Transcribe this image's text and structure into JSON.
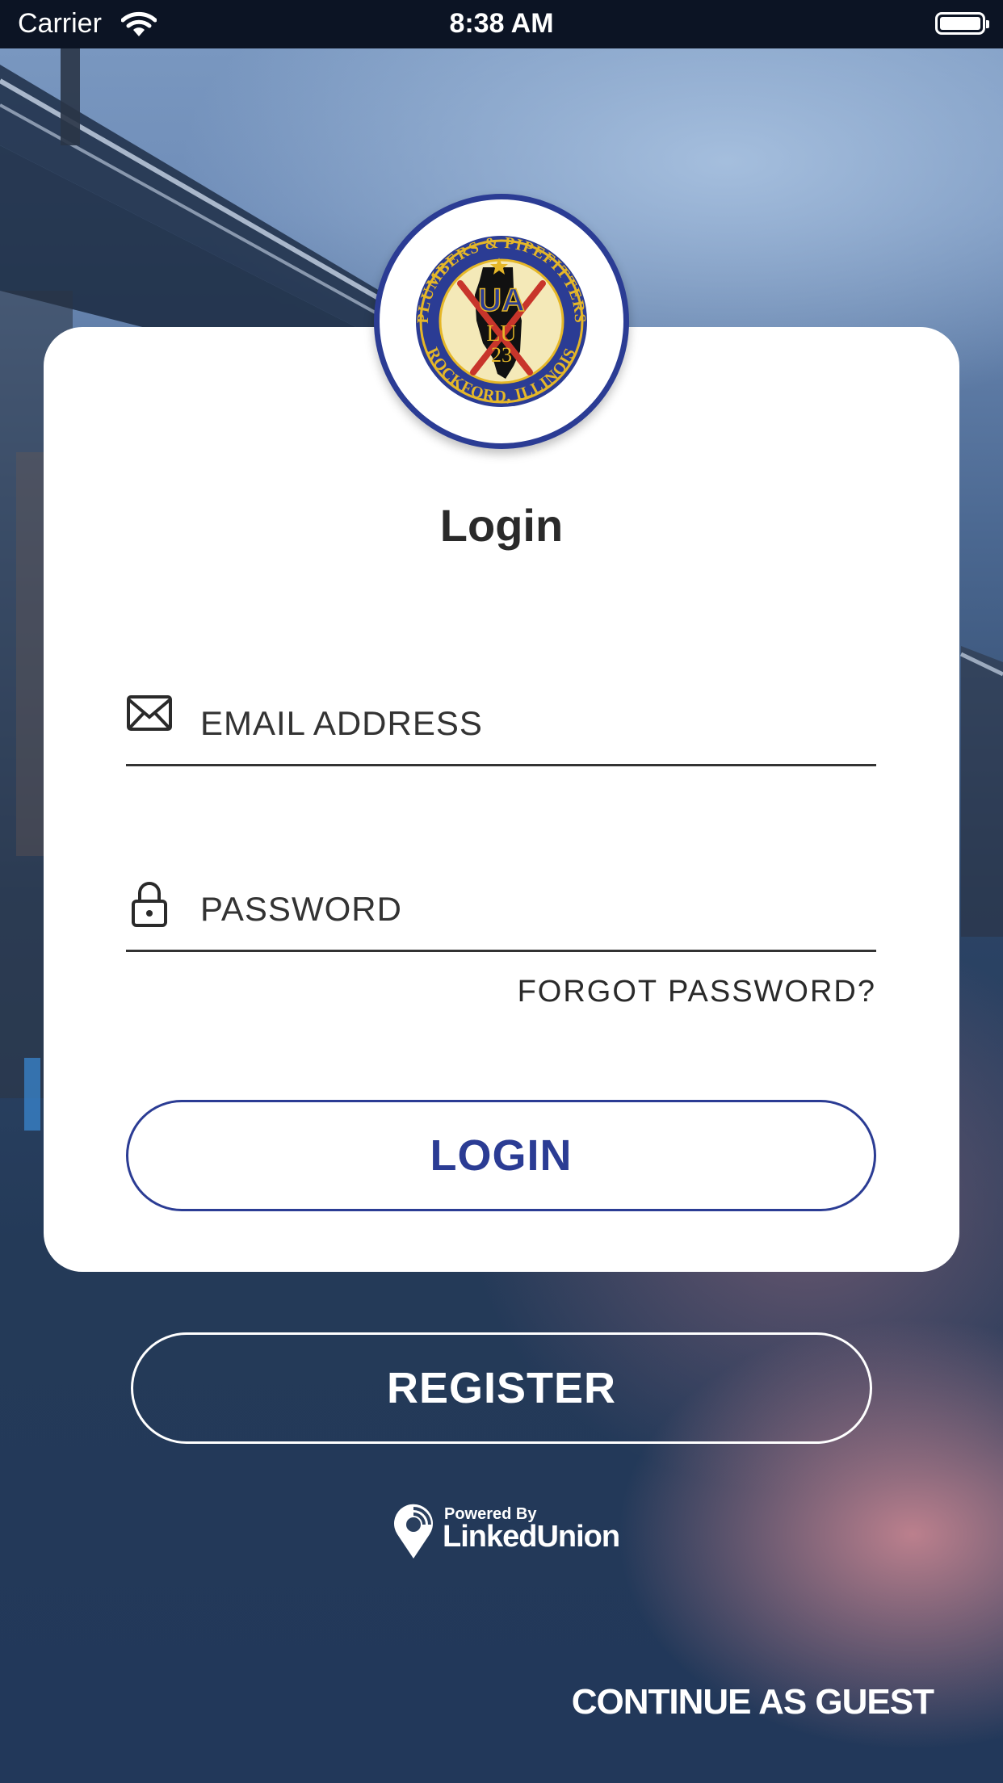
{
  "status_bar": {
    "carrier": "Carrier",
    "time": "8:38 AM"
  },
  "logo": {
    "ring_top": "PLUMBERS & PIPEFITTERS",
    "ring_bottom": "ROCKFORD, ILLINOIS",
    "center_top": "UA",
    "center_middle": "LU",
    "center_bottom": "23"
  },
  "login_card": {
    "title": "Login",
    "email_placeholder": "EMAIL ADDRESS",
    "email_value": "",
    "password_placeholder": "PASSWORD",
    "password_value": "",
    "forgot_password": "FORGOT PASSWORD?",
    "login_button": "LOGIN"
  },
  "register_button": "REGISTER",
  "powered_by": {
    "prefix": "Powered By",
    "brand": "LinkedUnion"
  },
  "continue_as_guest": "CONTINUE AS GUEST",
  "colors": {
    "accent": "#2b3c94",
    "card": "#ffffff",
    "status_bar": "#0c1424"
  }
}
